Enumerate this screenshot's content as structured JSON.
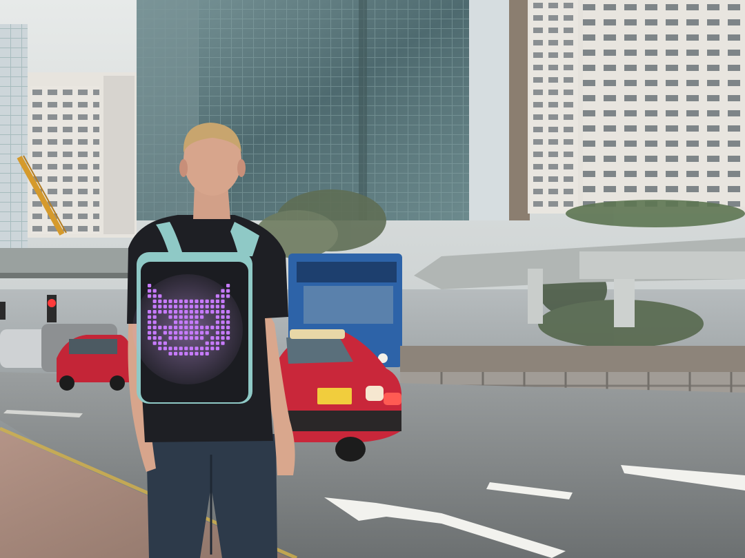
{
  "photo": {
    "subject": "person-with-led-backpack",
    "backpack_display": {
      "icon": "devil-emoji-icon",
      "led_color": "#c77bff",
      "led_glow": "#e6b8ff"
    },
    "palette": {
      "sky": "#dfe3e3",
      "glass_tower": "#5f7c80",
      "hotel_building": "#e6e3dd",
      "taxi_red": "#c9273a",
      "road": "#7b7f80",
      "sidewalk": "#a68a7e",
      "shirt": "#1e1f24",
      "jeans": "#2d3a4a",
      "backpack_strap": "#8fc9c6",
      "backpack_panel": "#1b1c21",
      "bus_blue": "#2d63a8"
    }
  }
}
